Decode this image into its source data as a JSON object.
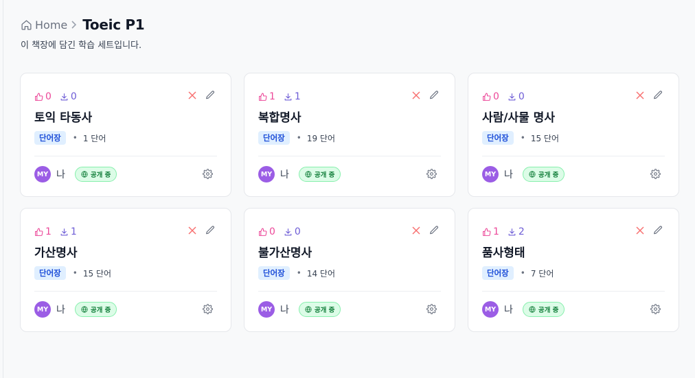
{
  "breadcrumb": {
    "home_label": "Home",
    "current": "Toeic P1"
  },
  "subtitle": "이 책장에 담긴 학습 세트입니다.",
  "cards": [
    {
      "likes": "0",
      "downloads": "0",
      "title": "토익 타동사",
      "type": "단어장",
      "count": "1 단어",
      "avatar": "MY",
      "owner": "나",
      "status": "공개 중"
    },
    {
      "likes": "1",
      "downloads": "1",
      "title": "복합명사",
      "type": "단어장",
      "count": "19 단어",
      "avatar": "MY",
      "owner": "나",
      "status": "공개 중"
    },
    {
      "likes": "0",
      "downloads": "0",
      "title": "사람/사물 명사",
      "type": "단어장",
      "count": "15 단어",
      "avatar": "MY",
      "owner": "나",
      "status": "공개 중"
    },
    {
      "likes": "1",
      "downloads": "1",
      "title": "가산명사",
      "type": "단어장",
      "count": "15 단어",
      "avatar": "MY",
      "owner": "나",
      "status": "공개 중"
    },
    {
      "likes": "0",
      "downloads": "0",
      "title": "불가산명사",
      "type": "단어장",
      "count": "14 단어",
      "avatar": "MY",
      "owner": "나",
      "status": "공개 중"
    },
    {
      "likes": "1",
      "downloads": "2",
      "title": "품사형태",
      "type": "단어장",
      "count": "7 단어",
      "avatar": "MY",
      "owner": "나",
      "status": "공개 중"
    }
  ],
  "icons": {
    "home": "home-icon",
    "chevron": "chevron-right-icon",
    "like": "thumbs-up-icon",
    "download": "download-icon",
    "delete": "close-icon",
    "edit": "pencil-icon",
    "public": "globe-icon",
    "settings": "gear-icon"
  },
  "colors": {
    "likes": "#ec4899",
    "downloads": "#6d5cd6",
    "delete": "#f87171",
    "badge_bg": "#e0efff",
    "badge_text": "#1d4ed8",
    "avatar": "#9b5de5",
    "public_bg": "#dcfce7",
    "public_text": "#15803d"
  }
}
